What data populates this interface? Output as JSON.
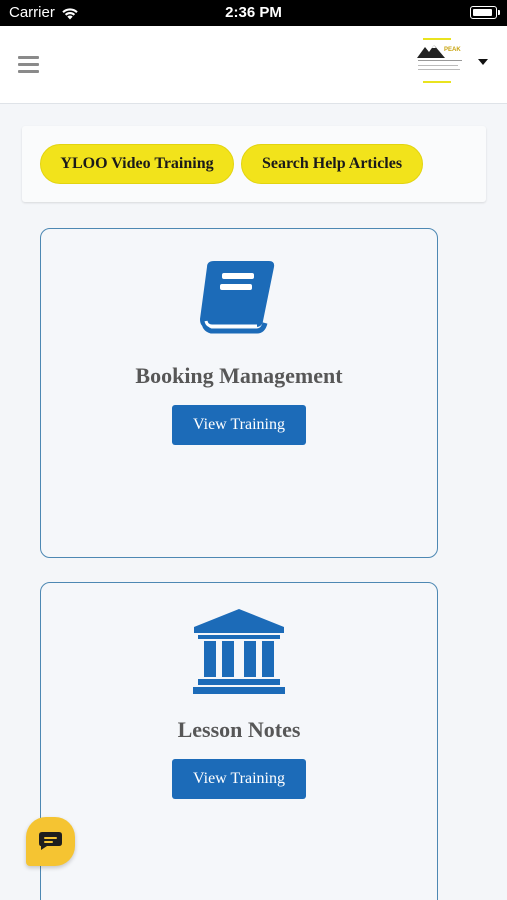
{
  "status_bar": {
    "carrier": "Carrier",
    "time": "2:36 PM"
  },
  "header": {
    "menu_icon": "hamburger-icon",
    "logo_name": "PEAK",
    "dropdown_icon": "caret-down-icon"
  },
  "quick_links": [
    {
      "label": "YLOO Video Training"
    },
    {
      "label": "Search Help Articles"
    }
  ],
  "cards": [
    {
      "title": "Booking Management",
      "icon": "book-icon",
      "button_label": "View Training"
    },
    {
      "title": "Lesson Notes",
      "icon": "bank-icon",
      "button_label": "View Training"
    }
  ],
  "chat": {
    "icon": "chat-icon"
  },
  "colors": {
    "accent_yellow": "#f2e31b",
    "primary_blue": "#1c6bb8",
    "card_border": "#4d88b3",
    "title_gray": "#575757"
  }
}
